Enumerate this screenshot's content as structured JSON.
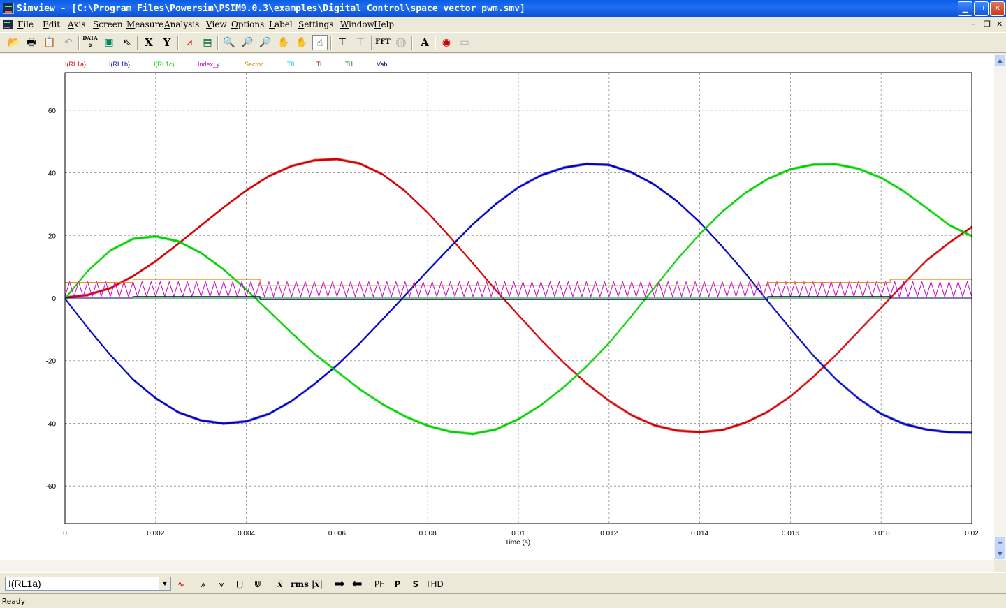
{
  "window": {
    "title": "Simview - [C:\\Program Files\\Powersim\\PSIM9.0.3\\examples\\Digital Control\\space vector pwm.smv]"
  },
  "menu": [
    "File",
    "Edit",
    "Axis",
    "Screen",
    "Measure",
    "Analysis",
    "View",
    "Options",
    "Label",
    "Settings",
    "Window",
    "Help"
  ],
  "toolbar": {
    "x_label": "X",
    "y_label": "Y",
    "fft_label": "FFT",
    "text_label": "A",
    "data_label": "DATA"
  },
  "legend": [
    {
      "name": "I(RL1a)",
      "color": "#d00000"
    },
    {
      "name": "I(RL1b)",
      "color": "#0000c0"
    },
    {
      "name": "I(RL1c)",
      "color": "#00d000"
    },
    {
      "name": "Index_y",
      "color": "#d000d0"
    },
    {
      "name": "Sector",
      "color": "#e08000"
    },
    {
      "name": "T0",
      "color": "#00b8d8"
    },
    {
      "name": "Ti",
      "color": "#a00000"
    },
    {
      "name": "Ti1",
      "color": "#008000"
    },
    {
      "name": "Vab",
      "color": "#000060"
    }
  ],
  "chart_data": {
    "type": "line",
    "xlabel": "Time (s)",
    "xlim": [
      0,
      0.02
    ],
    "ylim": [
      -72,
      72
    ],
    "x_ticks": [
      "0",
      "0.002",
      "0.004",
      "0.006",
      "0.008",
      "0.01",
      "0.012",
      "0.014",
      "0.016",
      "0.018",
      "0.02"
    ],
    "y_ticks": [
      "60",
      "40",
      "20",
      "0",
      "-20",
      "-40",
      "-60"
    ],
    "grid": true,
    "series": [
      {
        "name": "I(RL1a)",
        "color": "#d00000",
        "x": [
          0,
          0.0005,
          0.001,
          0.0015,
          0.002,
          0.0025,
          0.003,
          0.0035,
          0.004,
          0.0045,
          0.005,
          0.0055,
          0.006,
          0.0065,
          0.007,
          0.0075,
          0.008,
          0.0085,
          0.009,
          0.0095,
          0.01,
          0.0105,
          0.011,
          0.0115,
          0.012,
          0.0125,
          0.013,
          0.0135,
          0.014,
          0.0145,
          0.015,
          0.0155,
          0.016,
          0.0165,
          0.017,
          0.0175,
          0.018,
          0.0185,
          0.019,
          0.0195,
          0.02
        ],
        "y": [
          0,
          0.8,
          3,
          6.8,
          11.6,
          17.2,
          23,
          28.8,
          34.2,
          38.8,
          42,
          43.8,
          44.2,
          42.8,
          39.4,
          34,
          27.1,
          19.2,
          10.9,
          2.4,
          -5.6,
          -13.5,
          -20.8,
          -27.4,
          -33,
          -37.6,
          -40.8,
          -42.5,
          -43,
          -42.3,
          -40,
          -36.5,
          -31.6,
          -25.4,
          -18.4,
          -10.8,
          -3.3,
          4.4,
          11.8,
          17.5,
          22.5
        ]
      },
      {
        "name": "I(RL1b)",
        "color": "#0000c0",
        "x": [
          0,
          0.0005,
          0.001,
          0.0015,
          0.002,
          0.0025,
          0.003,
          0.0035,
          0.004,
          0.0045,
          0.005,
          0.0055,
          0.006,
          0.0065,
          0.007,
          0.0075,
          0.008,
          0.0085,
          0.009,
          0.0095,
          0.01,
          0.0105,
          0.011,
          0.0115,
          0.012,
          0.0125,
          0.013,
          0.0135,
          0.014,
          0.0145,
          0.015,
          0.0155,
          0.016,
          0.0165,
          0.017,
          0.0175,
          0.018,
          0.0185,
          0.019,
          0.0195,
          0.02
        ],
        "y": [
          0,
          -9.3,
          -18,
          -25.8,
          -31.8,
          -36.3,
          -38.9,
          -39.9,
          -39.2,
          -36.8,
          -32.7,
          -27.3,
          -21.3,
          -14.3,
          -6.7,
          1,
          8.9,
          16.5,
          23.8,
          30.2,
          35.5,
          39.4,
          41.8,
          43,
          42.7,
          40.3,
          36.4,
          31.1,
          24.4,
          16.6,
          8.2,
          -0.8,
          -9.6,
          -18.1,
          -25.7,
          -31.9,
          -36.8,
          -40,
          -41.8,
          -42.7,
          -42.8
        ]
      },
      {
        "name": "I(RL1c)",
        "color": "#00d000",
        "x": [
          0,
          0.0005,
          0.001,
          0.0015,
          0.002,
          0.0025,
          0.003,
          0.0035,
          0.004,
          0.0045,
          0.005,
          0.0055,
          0.006,
          0.0065,
          0.007,
          0.0075,
          0.008,
          0.0085,
          0.009,
          0.0095,
          0.01,
          0.0105,
          0.011,
          0.0115,
          0.012,
          0.0125,
          0.013,
          0.0135,
          0.014,
          0.0145,
          0.015,
          0.0155,
          0.016,
          0.0165,
          0.017,
          0.0175,
          0.018,
          0.0185,
          0.019,
          0.0195,
          0.02
        ],
        "y": [
          0,
          8.8,
          15.4,
          19.1,
          19.9,
          18.3,
          14.6,
          9.3,
          2.9,
          -4,
          -11,
          -17.6,
          -23.3,
          -28.9,
          -33.7,
          -37.6,
          -40.6,
          -42.5,
          -43.2,
          -41.8,
          -38.5,
          -34,
          -28.3,
          -21.7,
          -14.2,
          -5.5,
          3.5,
          12.5,
          20.6,
          27.8,
          33.7,
          38.2,
          41.3,
          42.8,
          42.9,
          41.5,
          38.6,
          34.3,
          29,
          23.5,
          20
        ]
      },
      {
        "name": "Index_y",
        "color": "#d000d0",
        "x": [
          0,
          0.02
        ],
        "y": [
          0,
          0
        ],
        "band": [
          0.5,
          5.2
        ]
      },
      {
        "name": "Sector",
        "color": "#e08000",
        "x": [
          0,
          0.0015,
          0.0015,
          0.0043,
          0.0043,
          0.0155,
          0.0155,
          0.0182,
          0.0182,
          0.02
        ],
        "y": [
          5,
          5,
          6,
          6,
          4,
          4,
          5,
          5,
          6,
          6
        ]
      },
      {
        "name": "T0",
        "color": "#00b8d8",
        "x": [
          0,
          0.02
        ],
        "y": [
          0,
          0
        ]
      },
      {
        "name": "Ti",
        "color": "#a00000",
        "x": [
          0,
          0.02
        ],
        "y": [
          0,
          0
        ]
      },
      {
        "name": "Ti1",
        "color": "#008000",
        "x": [
          0,
          0.02
        ],
        "y": [
          0,
          0
        ]
      },
      {
        "name": "Vab",
        "color": "#000060",
        "x": [
          0,
          0.0015,
          0.0015,
          0.0043,
          0.0043,
          0.0155,
          0.0155,
          0.0182,
          0.0182,
          0.02
        ],
        "y": [
          0,
          0,
          0.5,
          0.5,
          -0.5,
          -0.5,
          0.5,
          0.5,
          0,
          0
        ]
      }
    ]
  },
  "bottom": {
    "combo_value": "I(RL1a)",
    "rms_label": "rms",
    "pf_label": "PF",
    "p_label": "P",
    "s_label": "S",
    "thd_label": "THD"
  },
  "status": {
    "text": "Ready"
  }
}
